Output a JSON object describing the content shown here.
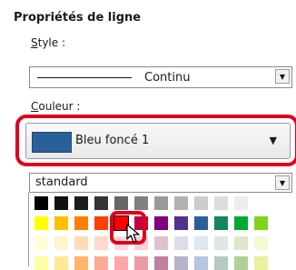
{
  "panel": {
    "title": "Propriétés de ligne",
    "style_label_underline": "S",
    "style_label_rest": "tyle :",
    "style_value": "Continu",
    "color_label_underline": "C",
    "color_label_rest": "ouleur :",
    "color_value": "Bleu foncé 1",
    "color_swatch": "#2a6099",
    "palette_set": "standard"
  },
  "icons": {
    "dropdown_arrow": "▼",
    "cursor": "mouse-pointer-icon"
  },
  "palette": {
    "rows": [
      [
        "#000000",
        "#111111",
        "#1c1c1c",
        "#333333",
        "#666666",
        "#808080",
        "#999999",
        "#b2b2b2",
        "#cccccc",
        "#dddddd",
        "#eeeeee",
        "#ffffff"
      ],
      [
        "#ffff00",
        "#ffbf00",
        "#ff8000",
        "#ff4000",
        "#ff0000",
        "#bf0041",
        "#800080",
        "#55308d",
        "#2a6099",
        "#158466",
        "#00a933",
        "#81d41a"
      ],
      [
        "#ffffd7",
        "#fff5ce",
        "#ffdbb6",
        "#ffd8ce",
        "#ffd7d7",
        "#f7d1d5",
        "#e0c2cd",
        "#dedce6",
        "#dee6ef",
        "#dee7e5",
        "#dde8cb",
        "#f6f9d4"
      ],
      [
        "#ffffa6",
        "#ffe994",
        "#ffb66c",
        "#ffaa95",
        "#ffa6a6",
        "#ec9ba4",
        "#bf819e",
        "#b7b3ca",
        "#b4c7dc",
        "#b3cac7",
        "#afd095",
        "#e8f2a1"
      ]
    ],
    "selected": "#ff0000"
  }
}
